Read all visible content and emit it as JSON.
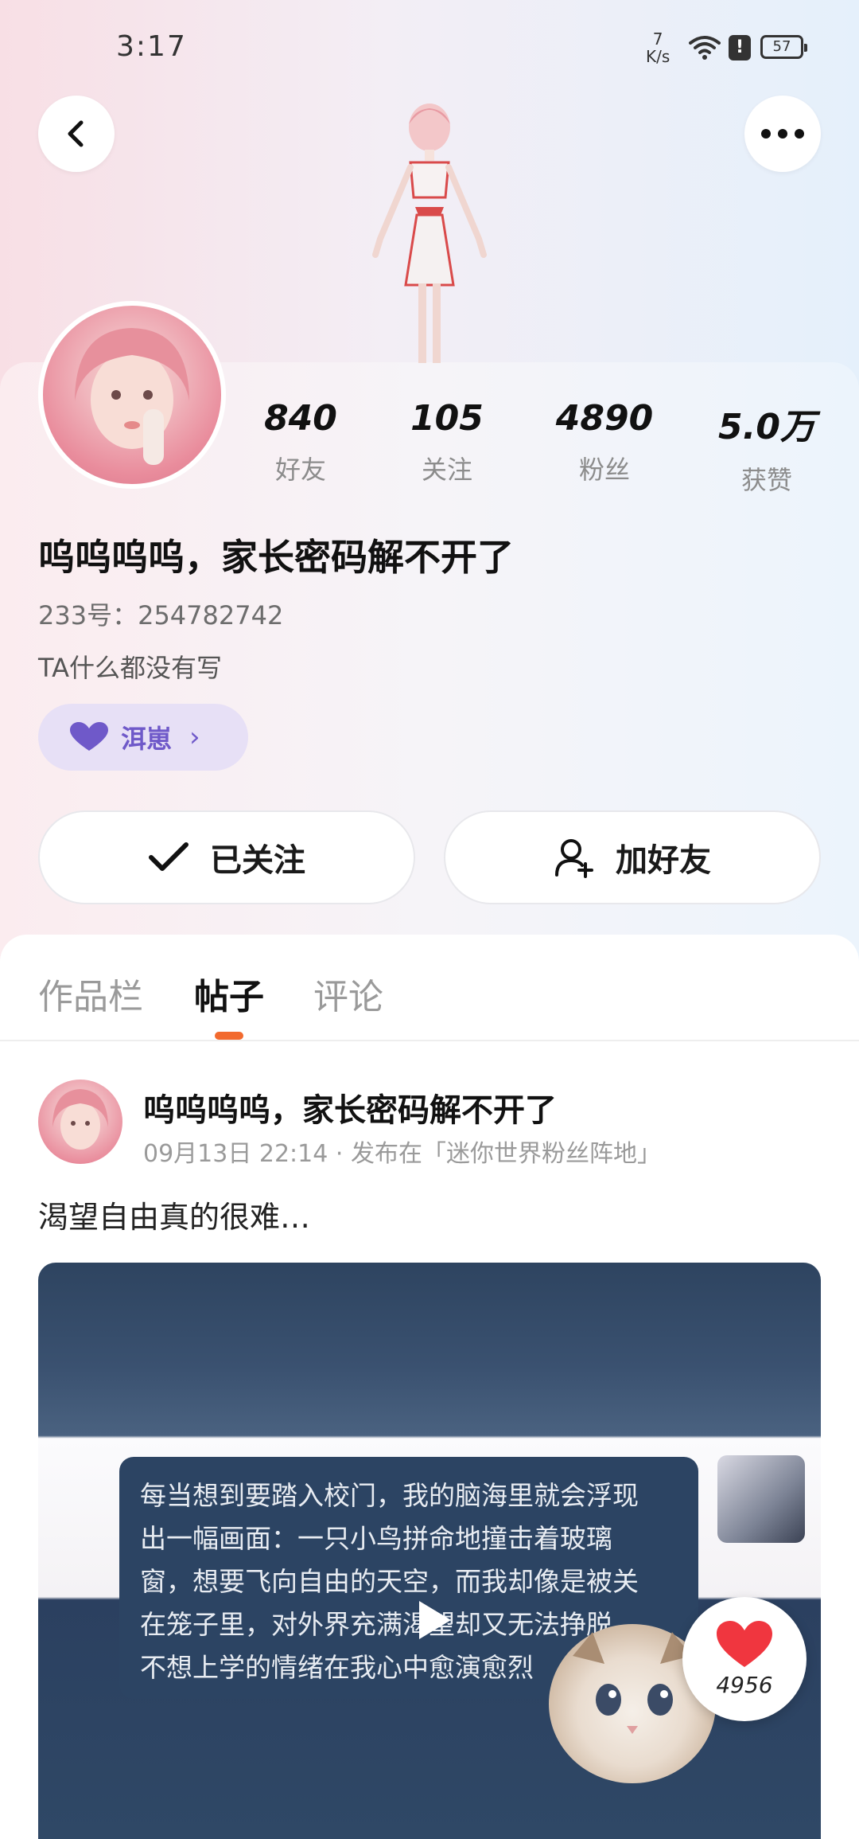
{
  "status_bar": {
    "time": "3:17",
    "net_speed_value": "7",
    "net_speed_unit": "K/s",
    "alert_symbol": "!",
    "battery": "57",
    "icons": [
      "wifi-icon",
      "alert-icon",
      "battery-icon"
    ]
  },
  "profile": {
    "stats": [
      {
        "value": "840",
        "label": "好友"
      },
      {
        "value": "105",
        "label": "关注"
      },
      {
        "value": "4890",
        "label": "粉丝"
      },
      {
        "value": "5.0万",
        "label": "获赞"
      }
    ],
    "username": "呜呜呜呜，家长密码解不开了",
    "id_line": "233号：254782742",
    "bio": "TA什么都没有写",
    "tag_label": "洱崽",
    "follow_button": "已关注",
    "add_friend_button": "加好友"
  },
  "tabs": [
    {
      "label": "作品栏",
      "active": false
    },
    {
      "label": "帖子",
      "active": true
    },
    {
      "label": "评论",
      "active": false
    }
  ],
  "post": {
    "author": "呜呜呜呜，家长密码解不开了",
    "meta": "09月13日 22:14 · 发布在「迷你世界粉丝阵地」",
    "text": "渴望自由真的很难…",
    "media_lines": [
      "每当想到要踏入校门，我的脑海里就会浮现",
      "出一幅画面：一只小鸟拼命地撞击着玻璃",
      "窗，想要飞向自由的天空，而我却像是被关",
      "在笼子里，对外界充满渴望却又无法挣脱，",
      "不想上学的情绪在我心中愈演愈烈"
    ],
    "likes": "4956"
  },
  "colors": {
    "accent": "#f26a2e",
    "tag_bg": "#e7e0f6",
    "tag_text": "#6f59c9",
    "like_heart": "#f0363f"
  }
}
